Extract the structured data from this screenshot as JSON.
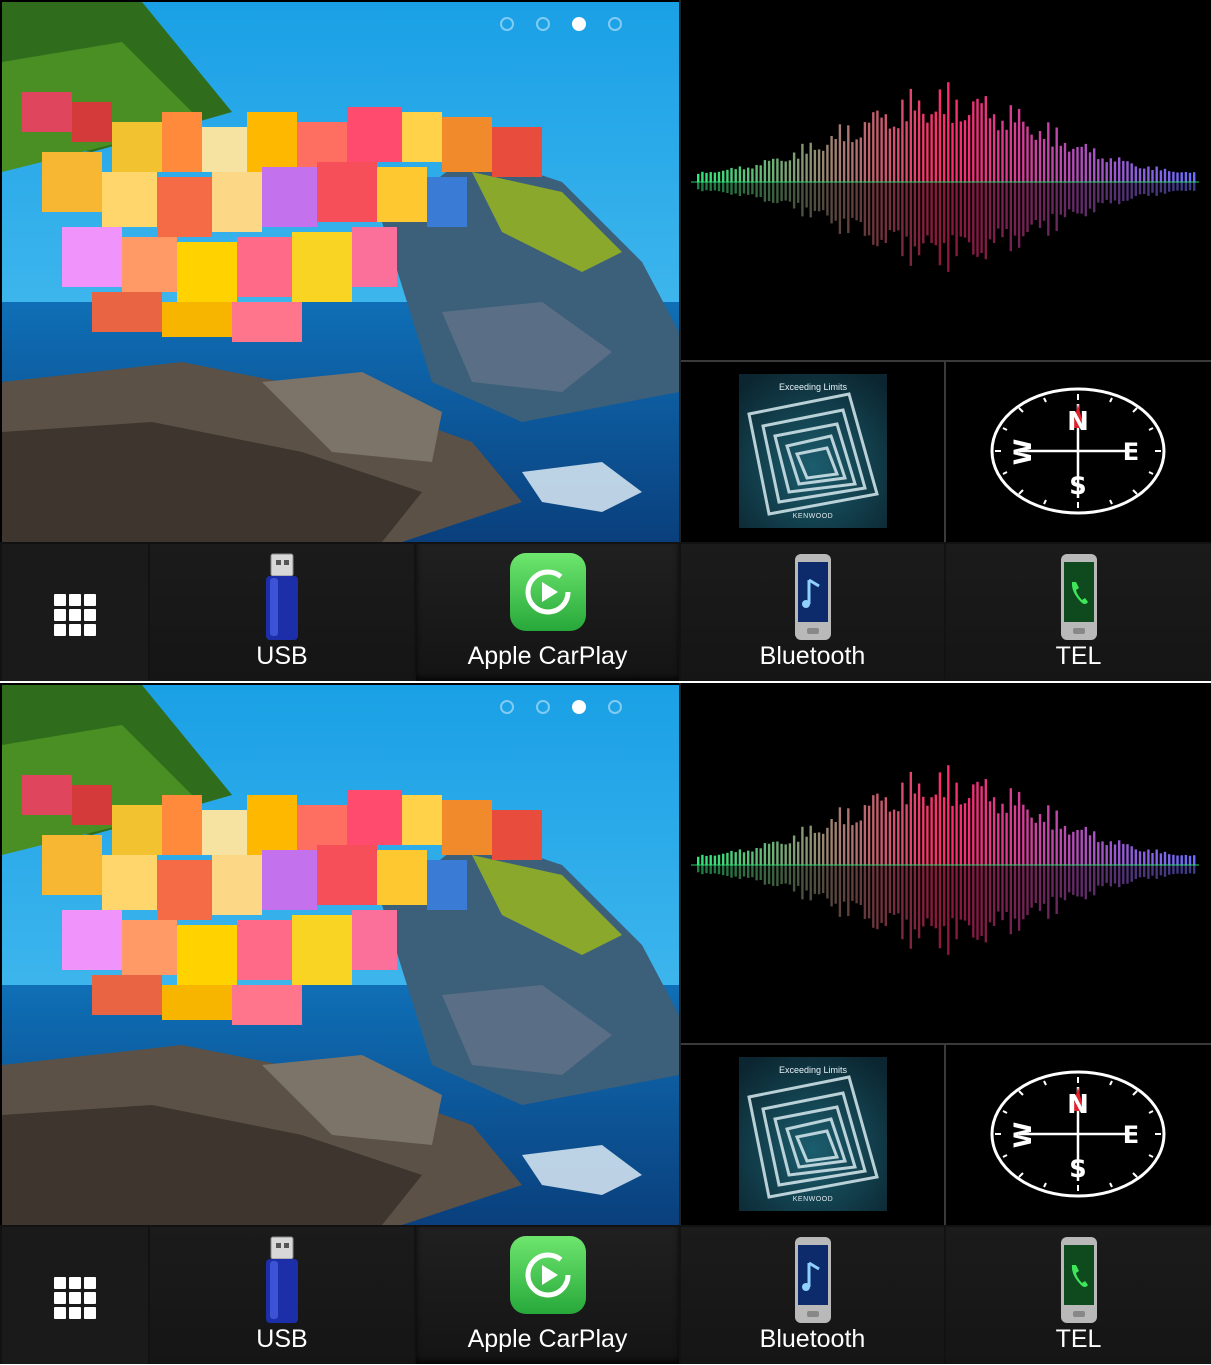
{
  "screens": [
    {
      "page_indicator": {
        "count": 4,
        "active": 3
      },
      "album": {
        "title": "Exceeding Limits",
        "brand": "KENWOOD"
      },
      "compass": {
        "north": "N",
        "east": "E",
        "south": "S",
        "west": "W",
        "needle_color": "#e0202a"
      },
      "dock": [
        {
          "id": "menu",
          "label": ""
        },
        {
          "id": "usb",
          "label": "USB"
        },
        {
          "id": "carplay",
          "label": "Apple CarPlay"
        },
        {
          "id": "bluetooth",
          "label": "Bluetooth"
        },
        {
          "id": "tel",
          "label": "TEL"
        }
      ]
    },
    {
      "page_indicator": {
        "count": 4,
        "active": 3
      },
      "album": {
        "title": "Exceeding Limits",
        "brand": "KENWOOD"
      },
      "compass": {
        "north": "N",
        "east": "E",
        "south": "S",
        "west": "W",
        "needle_color": "#e0202a"
      },
      "dock": [
        {
          "id": "menu",
          "label": ""
        },
        {
          "id": "usb",
          "label": "USB"
        },
        {
          "id": "carplay",
          "label": "Apple CarPlay"
        },
        {
          "id": "bluetooth",
          "label": "Bluetooth"
        },
        {
          "id": "tel",
          "label": "TEL"
        }
      ]
    }
  ],
  "colors": {
    "carplay_green": "#36c24a",
    "visualizer_start": "#2fe87a",
    "visualizer_mid": "#ff2a6a",
    "visualizer_end": "#6d6dff"
  }
}
